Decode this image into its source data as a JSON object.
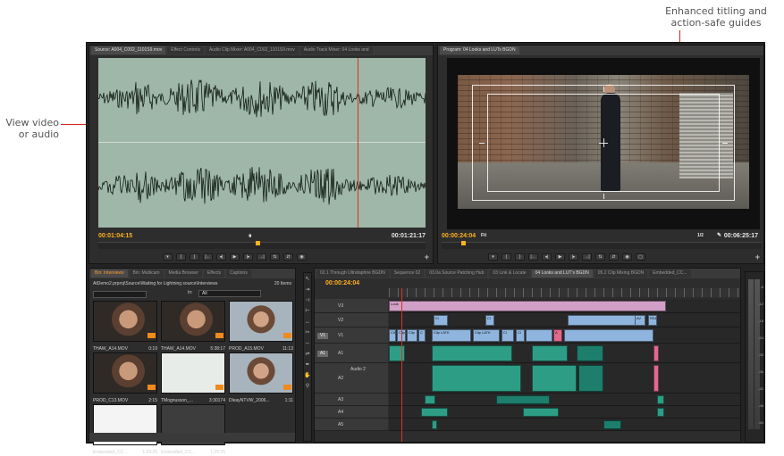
{
  "callouts": {
    "left": "View video\nor audio",
    "top": "Enhanced titling and\naction-safe guides"
  },
  "source_monitor": {
    "tabs": [
      "Source: A004_C002_1101S9.mov",
      "Effect Controls",
      "Audio Clip Mixer: A004_C002_1101S9.mov",
      "Audio Track Mixer: 04 Looks and"
    ],
    "timecode_in": "00:01:04:15",
    "timecode_out": "00:01:21:17",
    "colors": {
      "waveform_bg": "#9fb7a9",
      "timecode": "#ffb21e",
      "playhead": "#e03020"
    }
  },
  "program_monitor": {
    "tab": "Program: 04 Looks and LUTs BGDN",
    "timecode_in": "00:00:24:04",
    "fit": "Fit",
    "zoom": "1/2",
    "timecode_out": "00:06:25:17"
  },
  "project_panel": {
    "tabs": [
      "Bin: Interviews",
      "Bin: Multicam",
      "Media Browser",
      "Effects",
      "Captions"
    ],
    "path": "AtDemo2.prproj\\Source\\Waiting for Lightning source\\Interviews",
    "item_count": "20 Items",
    "in_label": "In:",
    "in_value": "All",
    "clips": [
      {
        "name": "THAW_A14.MOV",
        "duration": "0:19",
        "thumb": "face"
      },
      {
        "name": "THAW_A14.MOV",
        "duration": "5:38:17",
        "thumb": "face"
      },
      {
        "name": "PROD_A15.MOV",
        "duration": "11:13",
        "thumb": "face2"
      },
      {
        "name": "PROD_C13.MOV",
        "duration": "2:15",
        "thumb": "face"
      },
      {
        "name": "TMognusson_...",
        "duration": "3:30174",
        "thumb": "wave"
      },
      {
        "name": "DleayNTVW_2006...",
        "duration": "1:11",
        "thumb": "face2"
      },
      {
        "name": "Embedded_CC...",
        "duration": "1:29:25",
        "thumb": "white"
      },
      {
        "name": "Embedded_CC...",
        "duration": "1:29:25",
        "thumb": "blue"
      }
    ]
  },
  "timeline": {
    "tabs": [
      "02.1 Through Ultrafaphire BGDN",
      "Sequence 02",
      "03.0a Source Patching Hub",
      "03 Link & Locate",
      "04 Looks and LUT's BGDN",
      "05.2 Clip Mixing BGDN",
      "Embedded_CC..."
    ],
    "active_tab_index": 4,
    "timecode": "00:00:24:04",
    "tracks": [
      {
        "id": "V3",
        "src": ""
      },
      {
        "id": "V2",
        "src": ""
      },
      {
        "id": "V1",
        "src": "V1"
      },
      {
        "id": "A1",
        "src": "A1"
      },
      {
        "id": "A2",
        "src": ""
      },
      {
        "id": "A3",
        "src": ""
      },
      {
        "id": "A4",
        "src": ""
      },
      {
        "id": "A5",
        "src": ""
      }
    ],
    "audio2_label": "Audio 2",
    "clip_labels": {
      "look": "Look",
      "clip": "Clip",
      "clip_latk": "Clip LATK",
      "ad": "AV",
      "rdl": "RDL",
      "cl": "Cl"
    }
  },
  "meters": {
    "labels": [
      "-6",
      "-12",
      "-18",
      "-24",
      "-30",
      "-36",
      "-42",
      "-48",
      "-54"
    ]
  }
}
